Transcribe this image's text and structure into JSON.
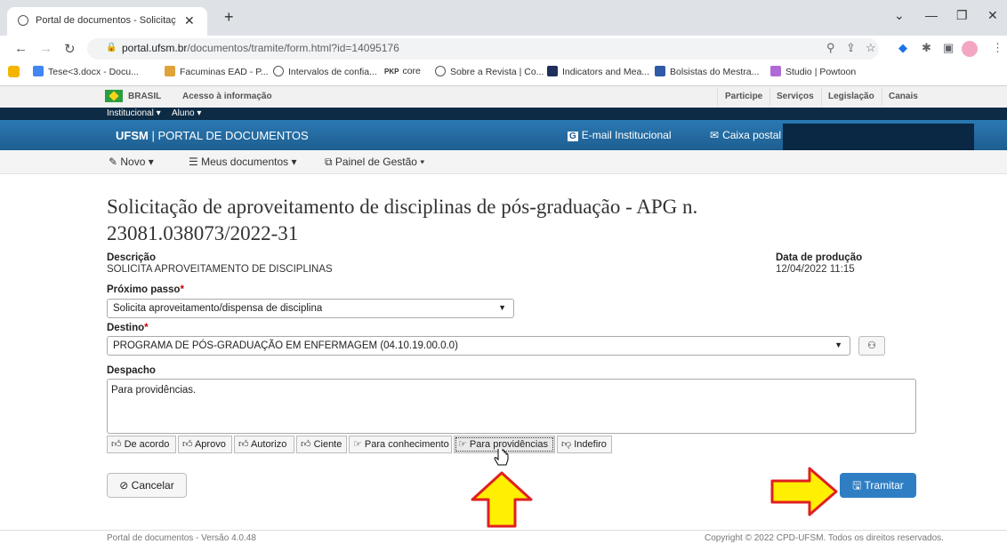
{
  "browser": {
    "tab_title": "Portal de documentos - Solicitaç",
    "url_host": "portal.ufsm.br",
    "url_path": "/documentos/tramite/form.html?id=14095176"
  },
  "bookmarks": [
    "Tese<3.docx - Docu...",
    "Facuminas EAD - P...",
    "Intervalos de confia...",
    "core",
    "Sobre a Revista | Co...",
    "Indicators and Mea...",
    "Bolsistas do Mestra...",
    "Studio | Powtoon"
  ],
  "gov": {
    "brasil": "BRASIL",
    "acesso": "Acesso à informação",
    "links": [
      "Participe",
      "Serviços",
      "Legislação",
      "Canais"
    ]
  },
  "darknav": {
    "institucional": "Institucional ▾",
    "aluno": "Aluno ▾"
  },
  "header": {
    "brand_bold": "UFSM",
    "brand_rest": " | PORTAL DE DOCUMENTOS",
    "email": "E-mail Institucional",
    "caixa": "Caixa postal"
  },
  "menu": {
    "novo": "Novo ▾",
    "meus": "Meus documentos ▾",
    "painel": "Painel de Gestão ▾"
  },
  "page": {
    "title": "Solicitação de aproveitamento de disciplinas de pós-graduação - APG n. 23081.038073/2022-31",
    "descricao_label": "Descrição",
    "descricao_value": "SOLICITA APROVEITAMENTO DE DISCIPLINAS",
    "data_label": "Data de produção",
    "data_value": "12/04/2022 11:15",
    "proximo_label": "Próximo passo",
    "proximo_value": "Solicita aproveitamento/dispensa de disciplina",
    "destino_label": "Destino",
    "destino_value": "PROGRAMA DE PÓS-GRADUAÇÃO EM ENFERMAGEM (04.10.19.00.0.0)",
    "despacho_label": "Despacho",
    "despacho_value": "Para providências.",
    "quick_buttons": [
      "De acordo",
      "Aprovo",
      "Autorizo",
      "Ciente",
      "Para conhecimento",
      "Para providências",
      "Indefiro"
    ],
    "cancel": "Cancelar",
    "tramitar": "Tramitar"
  },
  "footer": {
    "version": "Portal de documentos - Versão 4.0.48",
    "copyright": "Copyright © 2022 CPD-UFSM. Todos os direitos reservados."
  }
}
